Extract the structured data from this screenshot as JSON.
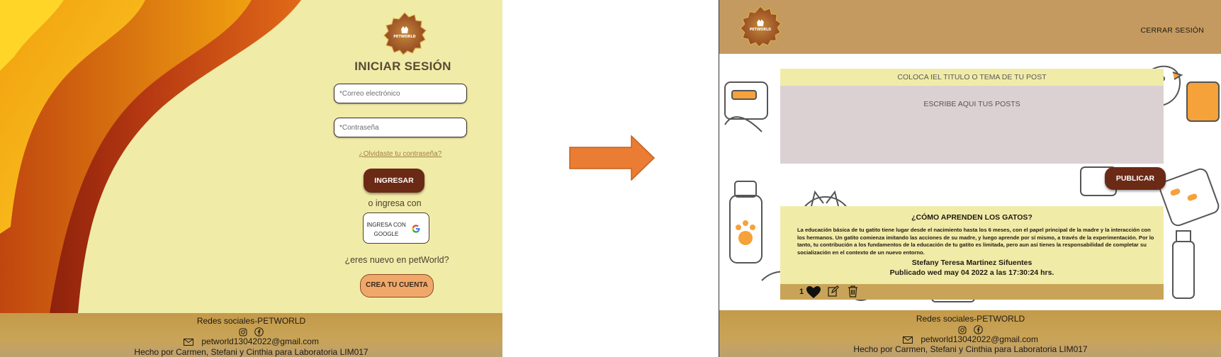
{
  "login_screen": {
    "title": "INICIAR SESIÓN",
    "email_placeholder": "*Correo electrónico",
    "password_placeholder": "*Contraseña",
    "forgot_password": "¿Olvidaste tu contraseña?",
    "login_button": "INGRESAR",
    "or_text": "o ingresa con",
    "google_line1": "INGRESA CON",
    "google_line2": "GOOGLE",
    "new_user_question": "¿eres nuevo en petWorld?",
    "create_account_button": "CREA TU CUENTA",
    "logo_text": "PETWORLD"
  },
  "feed_screen": {
    "logout_label": "CERRAR SESIÓN",
    "logo_text": "PETWORLD",
    "compose": {
      "title_placeholder": "COLOCA IEL TITULO O  TEMA DE TU POST",
      "body_placeholder": "ESCRIBE AQUI TUS POSTS",
      "publish_button": "PUBLICAR"
    },
    "post": {
      "title": "¿CÓMO APRENDEN LOS GATOS?",
      "body": "La educación básica de tu gatito tiene lugar desde el nacimiento hasta los 6 meses, con el papel principal de la madre y la interacción con los hermanos. Un gatito comienza imitando las acciones de su madre, y luego aprende por sí mismo, a través de la experimentación. Por lo tanto, tu contribución a los fundamentos de la educación de tu gatito es limitada, pero aun así tienes la responsabilidad de completar su socialización en el contexto de un nuevo entorno.",
      "author": "Stefany Teresa Martinez Sifuentes",
      "published": "Publicado  wed may  04 2022 a las 17:30:24 hrs.",
      "likes": "1"
    }
  },
  "footer": {
    "title": "Redes sociales-PETWORLD",
    "email": "petworld13042022@gmail.com",
    "credits": "Hecho por Carmen, Stefani y Cinthia para Laboratoria LIM017"
  },
  "colors": {
    "cream": "#f1eba8",
    "brown_button": "#6b2a16",
    "orange_button": "#f0a86a",
    "footer_gold": "#c49a4a",
    "arrow_orange": "#ea7d33"
  },
  "icons": [
    "instagram-icon",
    "facebook-icon",
    "mail-icon",
    "google-icon",
    "heart-icon",
    "edit-icon",
    "trash-icon",
    "arrow-right-icon"
  ]
}
